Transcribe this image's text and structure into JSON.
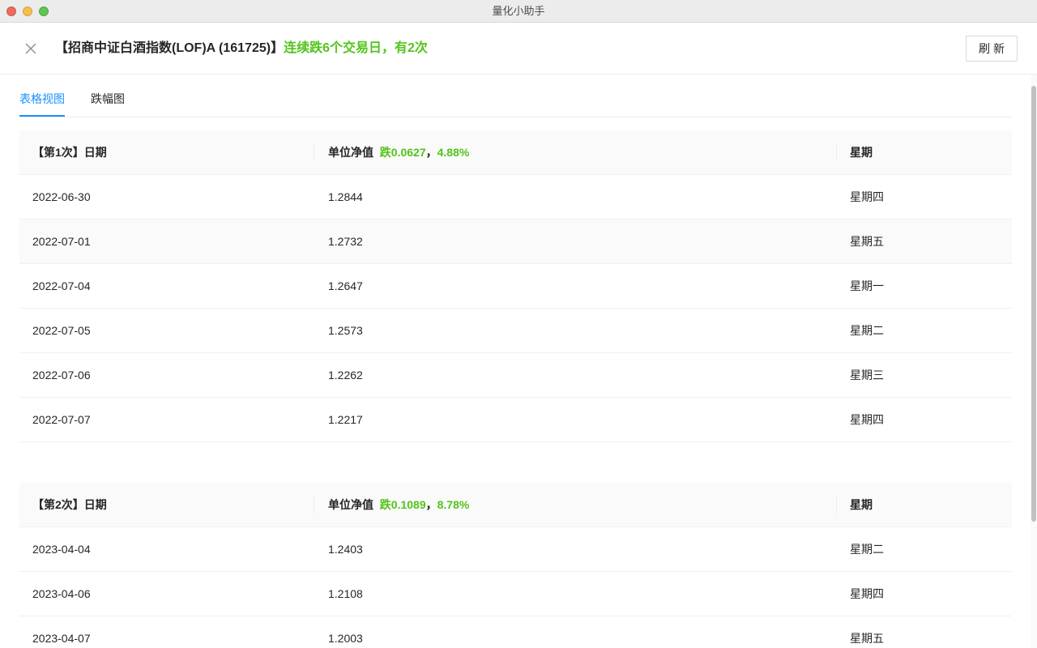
{
  "window": {
    "title": "量化小助手"
  },
  "header": {
    "fund": "【招商中证白酒指数(LOF)A (161725)】",
    "summary": "连续跌6个交易日，有2次",
    "refresh_label": "刷新"
  },
  "tabs": [
    {
      "label": "表格视图",
      "active": true
    },
    {
      "label": "跌幅图",
      "active": false
    }
  ],
  "tables": [
    {
      "col_date": "【第1次】日期",
      "col_value": "单位净值",
      "drop_text": "跌0.0627",
      "sep": "，",
      "drop_pct": "4.88%",
      "col_weekday": "星期",
      "rows": [
        {
          "date": "2022-06-30",
          "value": "1.2844",
          "weekday": "星期四"
        },
        {
          "date": "2022-07-01",
          "value": "1.2732",
          "weekday": "星期五"
        },
        {
          "date": "2022-07-04",
          "value": "1.2647",
          "weekday": "星期一"
        },
        {
          "date": "2022-07-05",
          "value": "1.2573",
          "weekday": "星期二"
        },
        {
          "date": "2022-07-06",
          "value": "1.2262",
          "weekday": "星期三"
        },
        {
          "date": "2022-07-07",
          "value": "1.2217",
          "weekday": "星期四"
        }
      ]
    },
    {
      "col_date": "【第2次】日期",
      "col_value": "单位净值",
      "drop_text": "跌0.1089",
      "sep": "，",
      "drop_pct": "8.78%",
      "col_weekday": "星期",
      "rows": [
        {
          "date": "2023-04-04",
          "value": "1.2403",
          "weekday": "星期二"
        },
        {
          "date": "2023-04-06",
          "value": "1.2108",
          "weekday": "星期四"
        },
        {
          "date": "2023-04-07",
          "value": "1.2003",
          "weekday": "星期五"
        }
      ]
    }
  ],
  "colors": {
    "accent": "#1890ff",
    "drop_green": "#52c41a"
  }
}
